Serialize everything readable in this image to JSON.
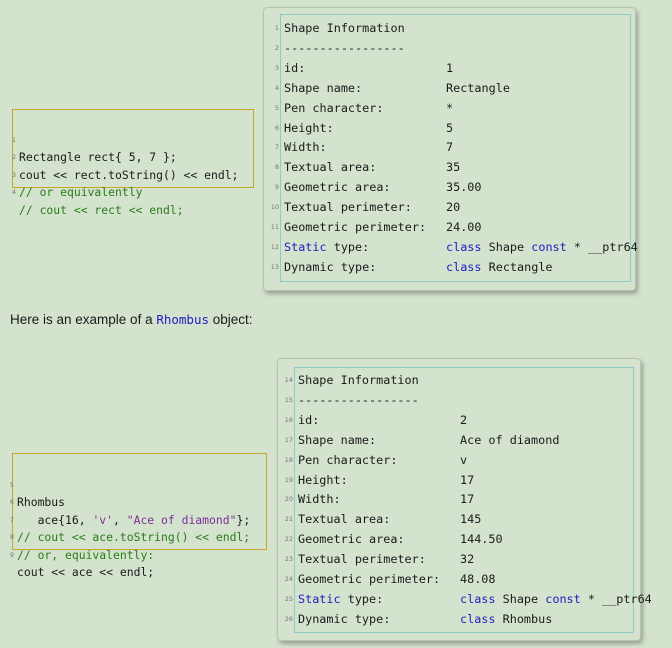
{
  "block1": {
    "code": [
      {
        "n": "1",
        "text": "Rectangle rect{ 5, 7 };",
        "type": "code"
      },
      {
        "n": "2",
        "text": "cout << rect.toString() << endl;",
        "type": "code"
      },
      {
        "n": "3",
        "text": "// or equivalently",
        "type": "comment"
      },
      {
        "n": "4",
        "text": "// cout << rect << endl;",
        "type": "comment"
      }
    ],
    "output": [
      {
        "n": "1",
        "label": "Shape Information",
        "value": ""
      },
      {
        "n": "2",
        "label": "-----------------",
        "value": ""
      },
      {
        "n": "3",
        "label": "id:",
        "value": "1"
      },
      {
        "n": "4",
        "label": "Shape name:",
        "value": "Rectangle"
      },
      {
        "n": "5",
        "label": "Pen character:",
        "value": "*"
      },
      {
        "n": "6",
        "label": "Height:",
        "value": "5"
      },
      {
        "n": "7",
        "label": "Width:",
        "value": "7"
      },
      {
        "n": "8",
        "label": "Textual area:",
        "value": "35"
      },
      {
        "n": "9",
        "label": "Geometric area:",
        "value": "35.00"
      },
      {
        "n": "10",
        "label": "Textual perimeter:",
        "value": "20"
      },
      {
        "n": "11",
        "label": "Geometric perimeter:",
        "value": "24.00"
      },
      {
        "n": "12",
        "label_kw": "Static",
        "label_rest": " type:",
        "v_kw1": "class",
        "v_mid": " Shape ",
        "v_kw2": "const",
        "v_rest": " * __ptr64"
      },
      {
        "n": "13",
        "label": "Dynamic type:",
        "v_kw1": "class",
        "v_mid": " Rectangle"
      }
    ]
  },
  "prose": {
    "before": "Here is an example of a ",
    "code": "Rhombus",
    "after": " object:"
  },
  "block2": {
    "code": [
      {
        "n": "5",
        "text": "Rhombus"
      },
      {
        "n": "6",
        "pre": "   ace{16, ",
        "s1": "'v'",
        "mid": ", ",
        "s2": "\"Ace of diamond\"",
        "post": "};"
      },
      {
        "n": "7",
        "text": "// cout << ace.toString() << endl;"
      },
      {
        "n": "8",
        "text": "// or, equivalently:"
      },
      {
        "n": "9",
        "text": "cout << ace << endl;"
      }
    ],
    "output": [
      {
        "n": "14",
        "label": "Shape Information",
        "value": ""
      },
      {
        "n": "15",
        "label": "-----------------",
        "value": ""
      },
      {
        "n": "16",
        "label": "id:",
        "value": "2"
      },
      {
        "n": "17",
        "label": "Shape name:",
        "value": "Ace of diamond"
      },
      {
        "n": "18",
        "label": "Pen character:",
        "value": "v"
      },
      {
        "n": "19",
        "label": "Height:",
        "value": "17"
      },
      {
        "n": "20",
        "label": "Width:",
        "value": "17"
      },
      {
        "n": "21",
        "label": "Textual area:",
        "value": "145"
      },
      {
        "n": "22",
        "label": "Geometric area:",
        "value": "144.50"
      },
      {
        "n": "23",
        "label": "Textual perimeter:",
        "value": "32"
      },
      {
        "n": "24",
        "label": "Geometric perimeter:",
        "value": "48.08"
      },
      {
        "n": "25",
        "label_kw": "Static",
        "label_rest": " type:",
        "v_kw1": "class",
        "v_mid": " Shape ",
        "v_kw2": "const",
        "v_rest": " * __ptr64"
      },
      {
        "n": "26",
        "label": "Dynamic type:",
        "v_kw1": "class",
        "v_mid": " Rhombus"
      }
    ]
  }
}
